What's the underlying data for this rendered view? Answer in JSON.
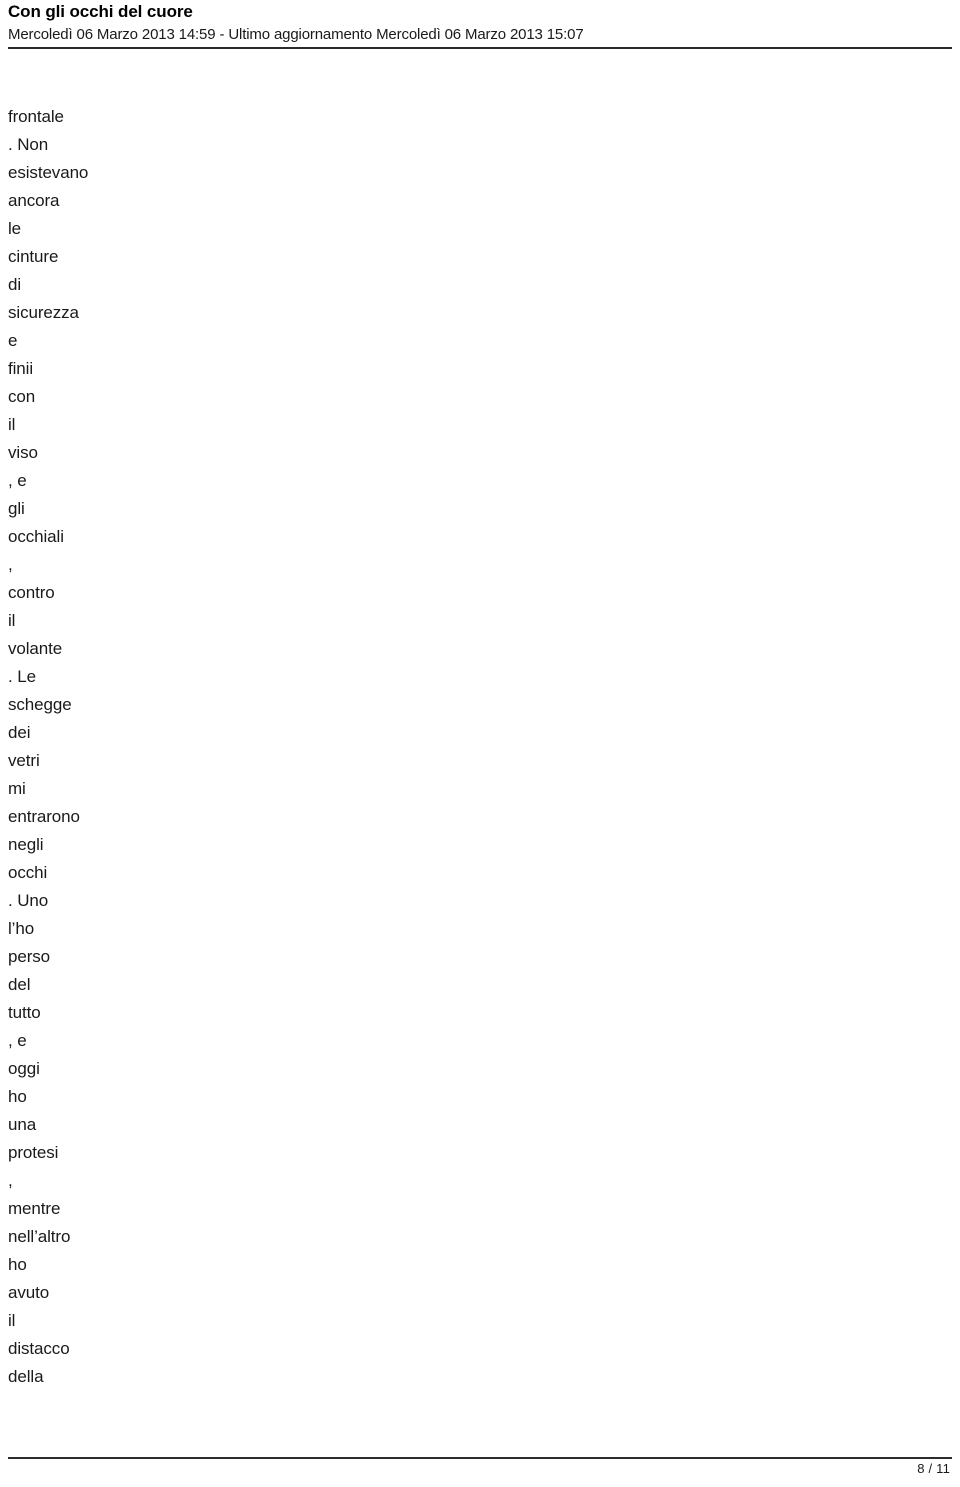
{
  "document": {
    "header": {
      "title": "Con gli occhi del cuore",
      "subtitle": "Mercoledì 06 Marzo 2013 14:59 - Ultimo aggiornamento Mercoledì 06 Marzo 2013 15:07"
    },
    "body": {
      "lines": [
        "frontale",
        ". Non",
        "esistevano",
        "ancora",
        "le",
        "cinture",
        "di",
        "sicurezza",
        "e",
        "finii",
        "con",
        "il",
        "viso",
        ", e",
        "gli",
        "occhiali",
        ",",
        "contro",
        "il",
        "volante",
        ". Le",
        "schegge",
        "dei",
        "vetri",
        "mi",
        "entrarono",
        "negli",
        "occhi",
        ". Uno",
        "l’ho",
        "perso",
        "del",
        "tutto",
        ", e",
        "oggi",
        "ho",
        "una",
        "protesi",
        ",",
        "mentre",
        "nell’altro",
        "ho",
        "avuto",
        "il",
        "distacco",
        "della"
      ]
    },
    "footer": {
      "page_label": "8 / 11",
      "current_page": "8",
      "total_pages": "11"
    },
    "colors": {
      "text": "#1a1a1a",
      "title": "#000000",
      "rule": "#2b2b2b",
      "background": "#ffffff"
    }
  }
}
